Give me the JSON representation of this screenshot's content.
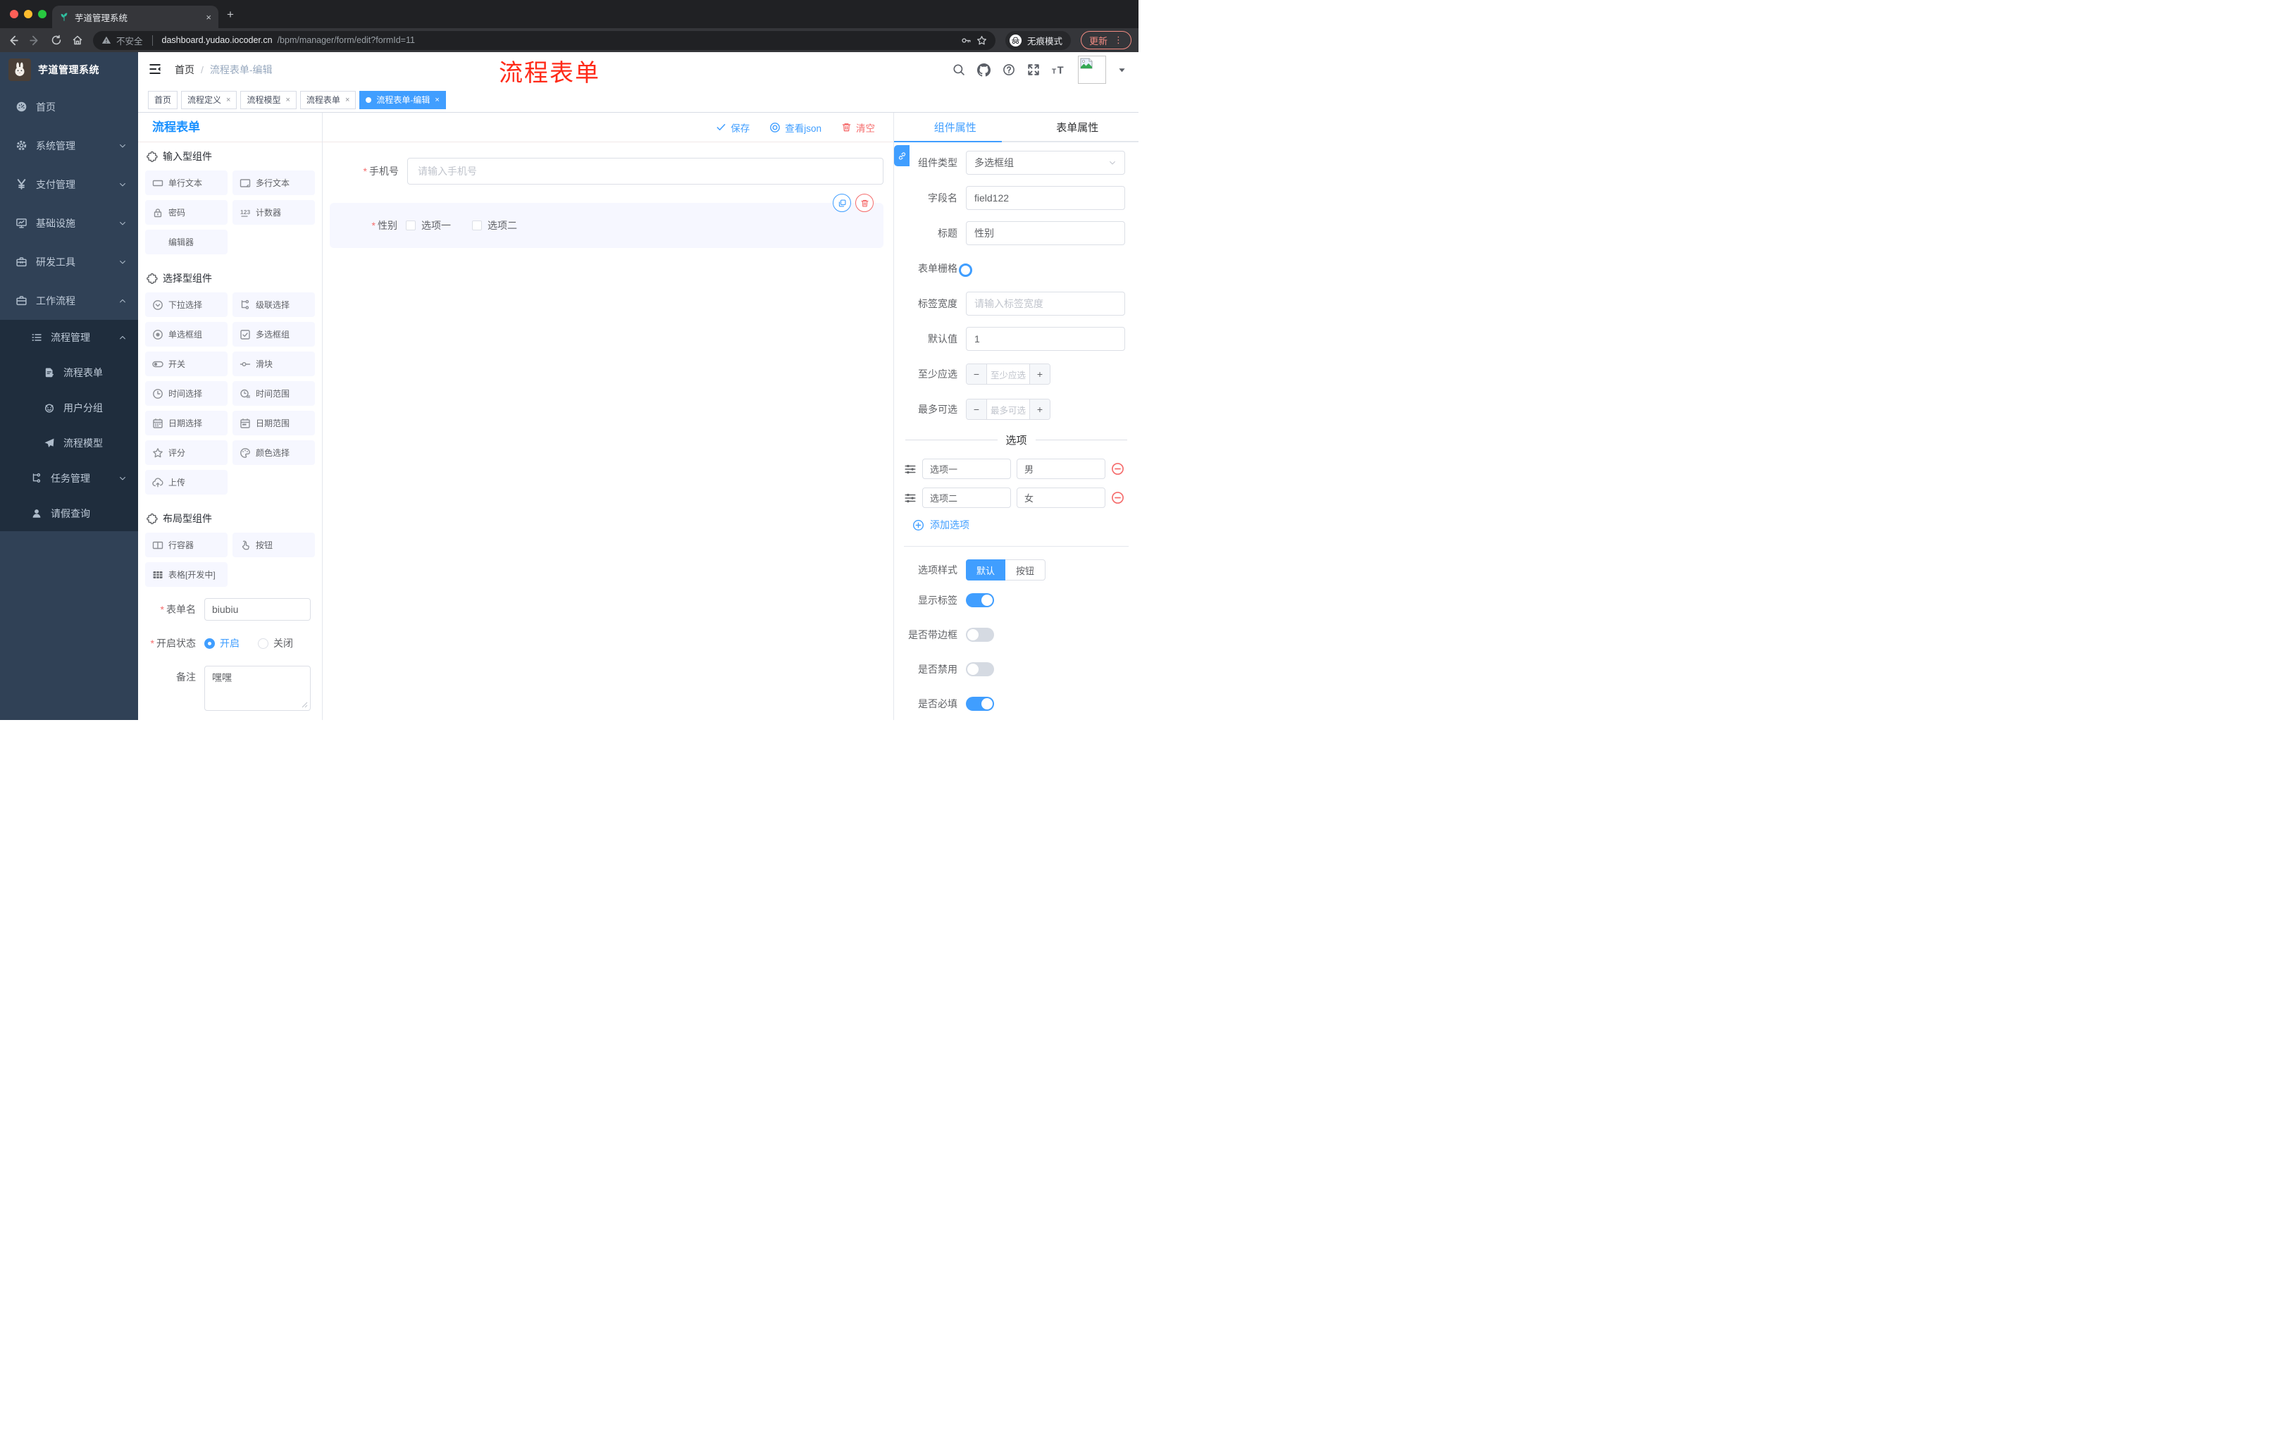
{
  "glyphs": {
    "close": "×",
    "plus": "+",
    "minus": "−",
    "dots": "⋮",
    "required": "*"
  },
  "browser": {
    "tab_title": "芋道管理系统",
    "security_label": "不安全",
    "url_domain": "dashboard.yudao.iocoder.cn",
    "url_path": "/bpm/manager/form/edit?formId=11",
    "incognito_label": "无痕模式",
    "update_label": "更新"
  },
  "sidebar": {
    "logo_title": "芋道管理系统",
    "items": [
      {
        "label": "首页"
      },
      {
        "label": "系统管理"
      },
      {
        "label": "支付管理"
      },
      {
        "label": "基础设施"
      },
      {
        "label": "研发工具"
      },
      {
        "label": "工作流程"
      },
      {
        "label": "流程管理"
      },
      {
        "label": "流程表单"
      },
      {
        "label": "用户分组"
      },
      {
        "label": "流程模型"
      },
      {
        "label": "任务管理"
      },
      {
        "label": "请假查询"
      }
    ]
  },
  "navbar": {
    "breadcrumb_home": "首页",
    "breadcrumb_sep": "/",
    "breadcrumb_current": "流程表单-编辑",
    "annotation": "流程表单"
  },
  "tags": [
    {
      "label": "首页"
    },
    {
      "label": "流程定义"
    },
    {
      "label": "流程模型"
    },
    {
      "label": "流程表单"
    },
    {
      "label": "流程表单-编辑"
    }
  ],
  "palette": {
    "title": "流程表单",
    "sections": [
      {
        "title": "输入型组件",
        "items": [
          "单行文本",
          "多行文本",
          "密码",
          "计数器",
          "编辑器"
        ]
      },
      {
        "title": "选择型组件",
        "items": [
          "下拉选择",
          "级联选择",
          "单选框组",
          "多选框组",
          "开关",
          "滑块",
          "时间选择",
          "时间范围",
          "日期选择",
          "日期范围",
          "评分",
          "颜色选择",
          "上传"
        ]
      },
      {
        "title": "布局型组件",
        "items": [
          "行容器",
          "按钮",
          "表格[开发中]"
        ]
      }
    ],
    "form": {
      "name_label": "表单名",
      "name_value": "biubiu",
      "status_label": "开启状态",
      "status_on": "开启",
      "status_off": "关闭",
      "remark_label": "备注",
      "remark_value": "嘿嘿"
    }
  },
  "canvas": {
    "toolbar": {
      "save": "保存",
      "view_json": "查看json",
      "clear": "清空"
    },
    "phone_field": {
      "label": "手机号",
      "placeholder": "请输入手机号"
    },
    "gender_field": {
      "label": "性别",
      "options": [
        "选项一",
        "选项二"
      ]
    }
  },
  "panel": {
    "tabs": {
      "component": "组件属性",
      "form": "表单属性"
    },
    "fields": {
      "type_label": "组件类型",
      "type_value": "多选框组",
      "name_label": "字段名",
      "name_value": "field122",
      "title_label": "标题",
      "title_value": "性别",
      "grid_label": "表单栅格",
      "labelwidth_label": "标签宽度",
      "labelwidth_placeholder": "请输入标签宽度",
      "default_label": "默认值",
      "default_value": "1",
      "min_label": "至少应选",
      "min_placeholder": "至少应选",
      "max_label": "最多可选",
      "max_placeholder": "最多可选"
    },
    "options": {
      "divider": "选项",
      "rows": [
        {
          "label": "选项一",
          "value": "男"
        },
        {
          "label": "选项二",
          "value": "女"
        }
      ],
      "add": "添加选项"
    },
    "style": {
      "label": "选项样式",
      "default": "默认",
      "button": "按钮",
      "toggles": [
        {
          "label": "显示标签"
        },
        {
          "label": "是否带边框"
        },
        {
          "label": "是否禁用"
        },
        {
          "label": "是否必填"
        }
      ]
    }
  }
}
